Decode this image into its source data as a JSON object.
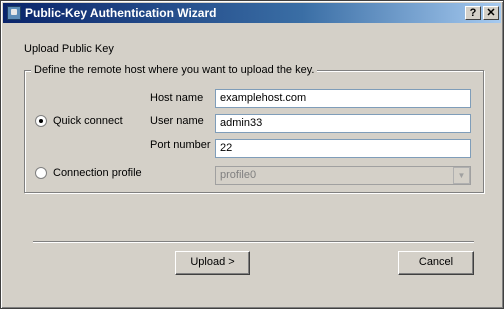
{
  "window": {
    "title": "Public-Key Authentication Wizard",
    "help_label": "?",
    "close_label": "✕"
  },
  "main": {
    "heading": "Upload Public Key",
    "group_legend": "Define the remote host where you want to upload the key.",
    "quick_connect": {
      "label": "Quick connect",
      "selected": true,
      "host_label": "Host name",
      "host_value": "examplehost.com",
      "user_label": "User name",
      "user_value": "admin33",
      "port_label": "Port number",
      "port_value": "22"
    },
    "connection_profile": {
      "label": "Connection profile",
      "selected": false,
      "profile_value": "profile0",
      "enabled": false
    }
  },
  "buttons": {
    "upload_label": "Upload >",
    "cancel_label": "Cancel"
  },
  "colors": {
    "titlebar_start": "#0a246a",
    "titlebar_end": "#a6caf0",
    "face": "#d4d0c8"
  }
}
